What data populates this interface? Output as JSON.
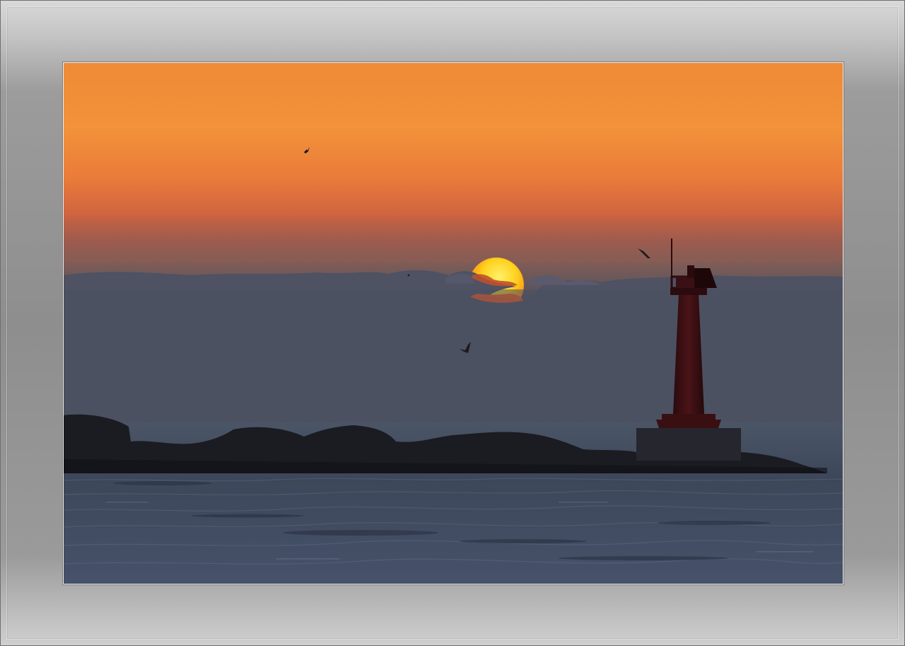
{
  "scene": {
    "subject": "lighthouse-at-sunset",
    "colors": {
      "frame": "#8e8e8e",
      "sky_top": "#ef8a36",
      "sky_mid": "#e4703a",
      "haze": "#4a5061",
      "sea": "#3f4a5d",
      "sun": "#ffd21e",
      "sun_edge": "#ff4a10",
      "lighthouse": "#3a0f12",
      "rocks": "#1b1b22"
    },
    "elements": [
      "sun",
      "clouds",
      "lighthouse",
      "breakwater-rocks",
      "sea",
      "birds"
    ]
  }
}
